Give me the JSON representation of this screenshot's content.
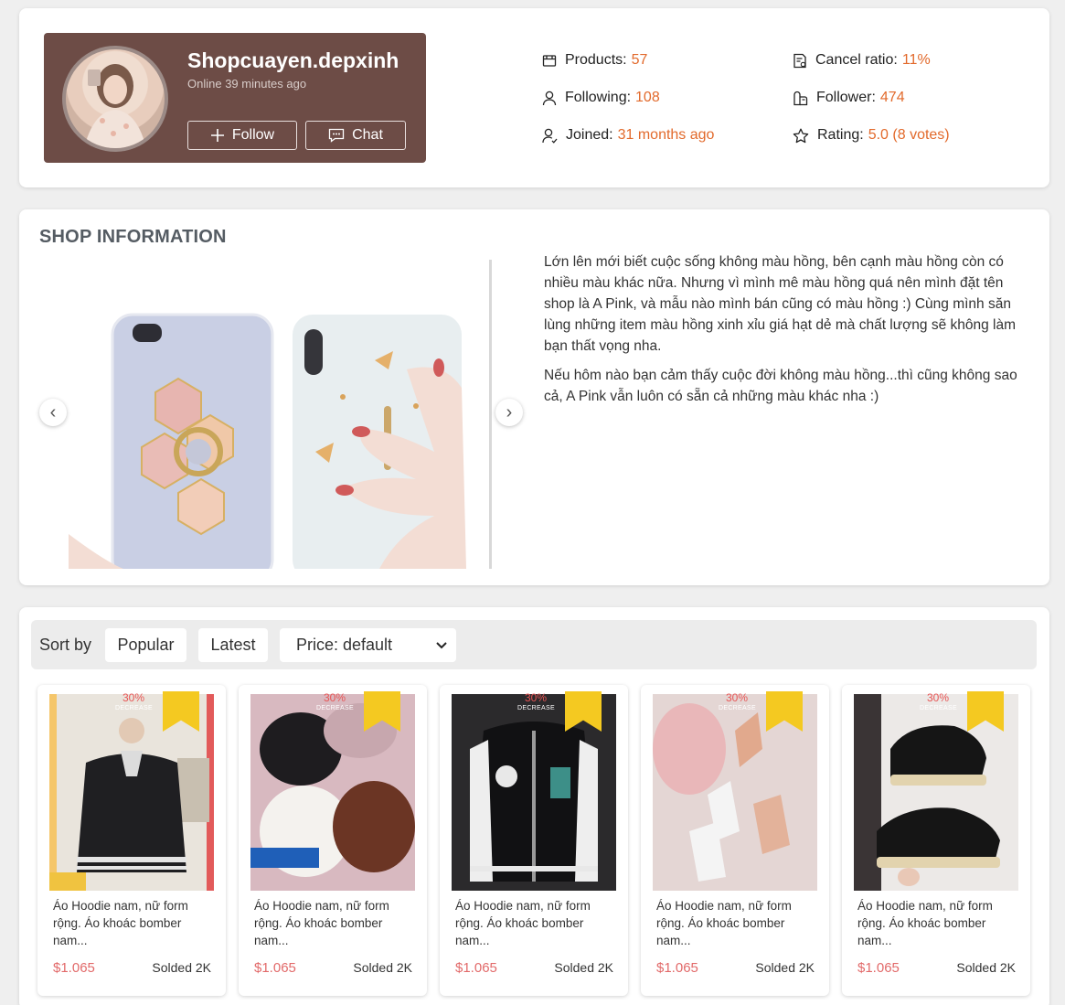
{
  "shop": {
    "name": "Shopcuayen.depxinh",
    "online": "Online 39 minutes ago",
    "follow_label": "Follow",
    "chat_label": "Chat"
  },
  "stats": {
    "products_label": "Products:",
    "products_value": "57",
    "following_label": "Following:",
    "following_value": "108",
    "joined_label": "Joined:",
    "joined_value": "31 months ago",
    "cancel_label": "Cancel ratio:",
    "cancel_value": "11%",
    "follower_label": "Follower:",
    "follower_value": "474",
    "rating_label": "Rating:",
    "rating_value": "5.0 (8 votes)"
  },
  "info": {
    "title": "SHOP INFORMATION",
    "prev_arrow": "‹",
    "next_arrow": "›",
    "paragraph1": "Lớn lên mới biết cuộc sống không màu hồng, bên cạnh màu hồng còn có nhiều màu khác nữa. Nhưng vì mình mê màu hồng quá nên mình đặt tên shop là A Pink, và mẫu nào mình bán cũng có màu hồng :) Cùng mình săn lùng những item màu hồng xinh xỉu giá hạt dẻ mà chất lượng sẽ không làm bạn thất vọng nha.",
    "paragraph2": "Nếu hôm nào bạn cảm thấy cuộc đời không màu hồng...thì cũng không sao cả, A Pink vẫn luôn có sẵn cả những màu khác nha :)"
  },
  "sort": {
    "label": "Sort by",
    "popular": "Popular",
    "latest": "Latest",
    "price": "Price: default",
    "chevron": "⌄"
  },
  "products": [
    {
      "name": "Áo Hoodie nam, nữ form rộng. Áo khoác bomber nam...",
      "price": "$1.065",
      "sold": "Solded 2K",
      "discount": "30%",
      "discount_sub": "DECREASE"
    },
    {
      "name": "Áo Hoodie nam, nữ form rộng. Áo khoác bomber nam...",
      "price": "$1.065",
      "sold": "Solded 2K",
      "discount": "30%",
      "discount_sub": "DECREASE"
    },
    {
      "name": "Áo Hoodie nam, nữ form rộng. Áo khoác bomber nam...",
      "price": "$1.065",
      "sold": "Solded 2K",
      "discount": "30%",
      "discount_sub": "DECREASE"
    },
    {
      "name": "Áo Hoodie nam, nữ form rộng. Áo khoác bomber nam...",
      "price": "$1.065",
      "sold": "Solded 2K",
      "discount": "30%",
      "discount_sub": "DECREASE"
    },
    {
      "name": "Áo Hoodie nam, nữ form rộng. Áo khoác bomber nam...",
      "price": "$1.065",
      "sold": "Solded 2K",
      "discount": "30%",
      "discount_sub": "DECREASE"
    }
  ],
  "colors": {
    "shop_box": "#6d4c46",
    "accent": "#e26a2c",
    "badge": "#f4c921",
    "price": "#e26a6a"
  }
}
